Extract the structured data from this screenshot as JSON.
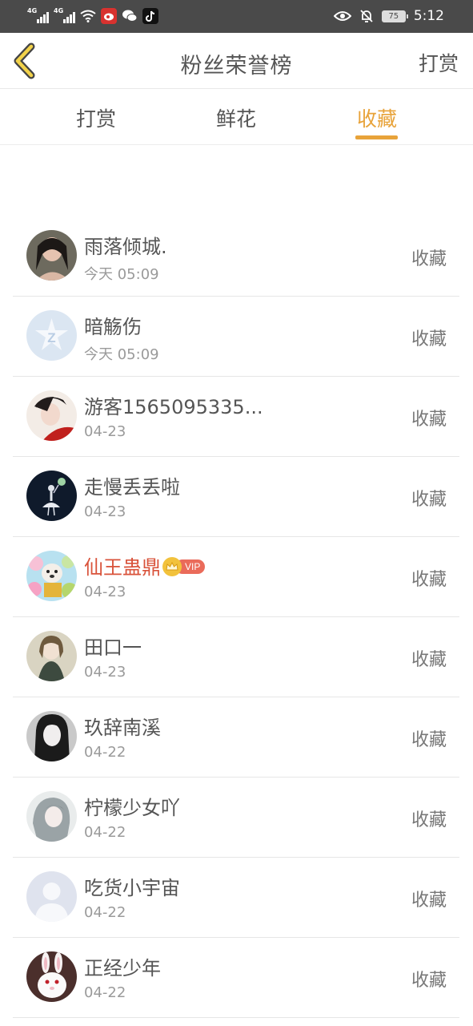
{
  "status_bar": {
    "signal1_label": "4G",
    "signal2_label": "4G",
    "battery": "75",
    "time": "5:12",
    "icons": [
      "signal-icon",
      "signal-icon",
      "wifi-icon",
      "weibo-app-icon",
      "wechat-icon",
      "tiktok-icon",
      "eye-icon",
      "mute-bell-icon",
      "battery-icon"
    ]
  },
  "header": {
    "back_icon": "chevron-left-icon",
    "title": "粉丝荣誉榜",
    "action_label": "打赏"
  },
  "tabs": [
    {
      "label": "打赏",
      "active": false
    },
    {
      "label": "鲜花",
      "active": false
    },
    {
      "label": "收藏",
      "active": true
    }
  ],
  "colors": {
    "accent": "#e8a33a",
    "vip_name": "#d9533b",
    "status_bar": "#4a4a4a"
  },
  "fans": [
    {
      "name": "雨落倾城.",
      "date": "今天 05:09",
      "action": "收藏"
    },
    {
      "name": "暗觞伤",
      "date": "今天 05:09",
      "action": "收藏"
    },
    {
      "name": "游客1565095335...",
      "date": "04-23",
      "action": "收藏"
    },
    {
      "name": "走慢丢丢啦",
      "date": "04-23",
      "action": "收藏"
    },
    {
      "name": "仙王蛊鼎",
      "date": "04-23",
      "action": "收藏",
      "vip_label": "VIP"
    },
    {
      "name": "田口一",
      "date": "04-23",
      "action": "收藏"
    },
    {
      "name": "玖辞南溪",
      "date": "04-22",
      "action": "收藏"
    },
    {
      "name": "柠檬少女吖",
      "date": "04-22",
      "action": "收藏"
    },
    {
      "name": "吃货小宇宙",
      "date": "04-22",
      "action": "收藏"
    },
    {
      "name": "正经少年",
      "date": "04-22",
      "action": "收藏"
    }
  ]
}
